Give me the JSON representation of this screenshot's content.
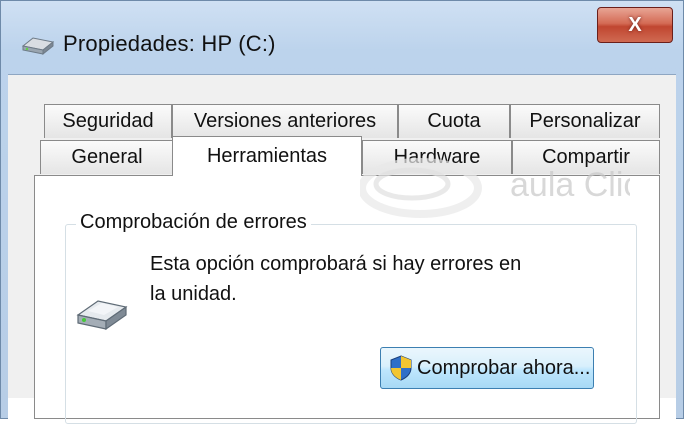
{
  "window": {
    "title": "Propiedades: HP (C:)",
    "close_label": "X"
  },
  "tabs_row1": [
    {
      "label": "Seguridad"
    },
    {
      "label": "Versiones anteriores"
    },
    {
      "label": "Cuota"
    },
    {
      "label": "Personalizar"
    }
  ],
  "tabs_row2": [
    {
      "label": "General"
    },
    {
      "label": "Herramientas",
      "active": true
    },
    {
      "label": "Hardware"
    },
    {
      "label": "Compartir"
    }
  ],
  "error_check": {
    "group_title": "Comprobación de errores",
    "description_line1": "Esta opción comprobará si hay errores en",
    "description_line2": "la unidad.",
    "button_label": "Comprobar ahora..."
  },
  "watermark": {
    "text": "aula Clic"
  },
  "colors": {
    "window_frame": "#bcd3ec",
    "close_button": "#c04630",
    "tab_border": "#8a8a8a",
    "button_border": "#3c7fb1",
    "watermark": "#e07b7b"
  },
  "icons": {
    "title_icon": "drive-icon",
    "group_icon": "hard-drive-icon",
    "button_icon": "uac-shield-icon"
  }
}
